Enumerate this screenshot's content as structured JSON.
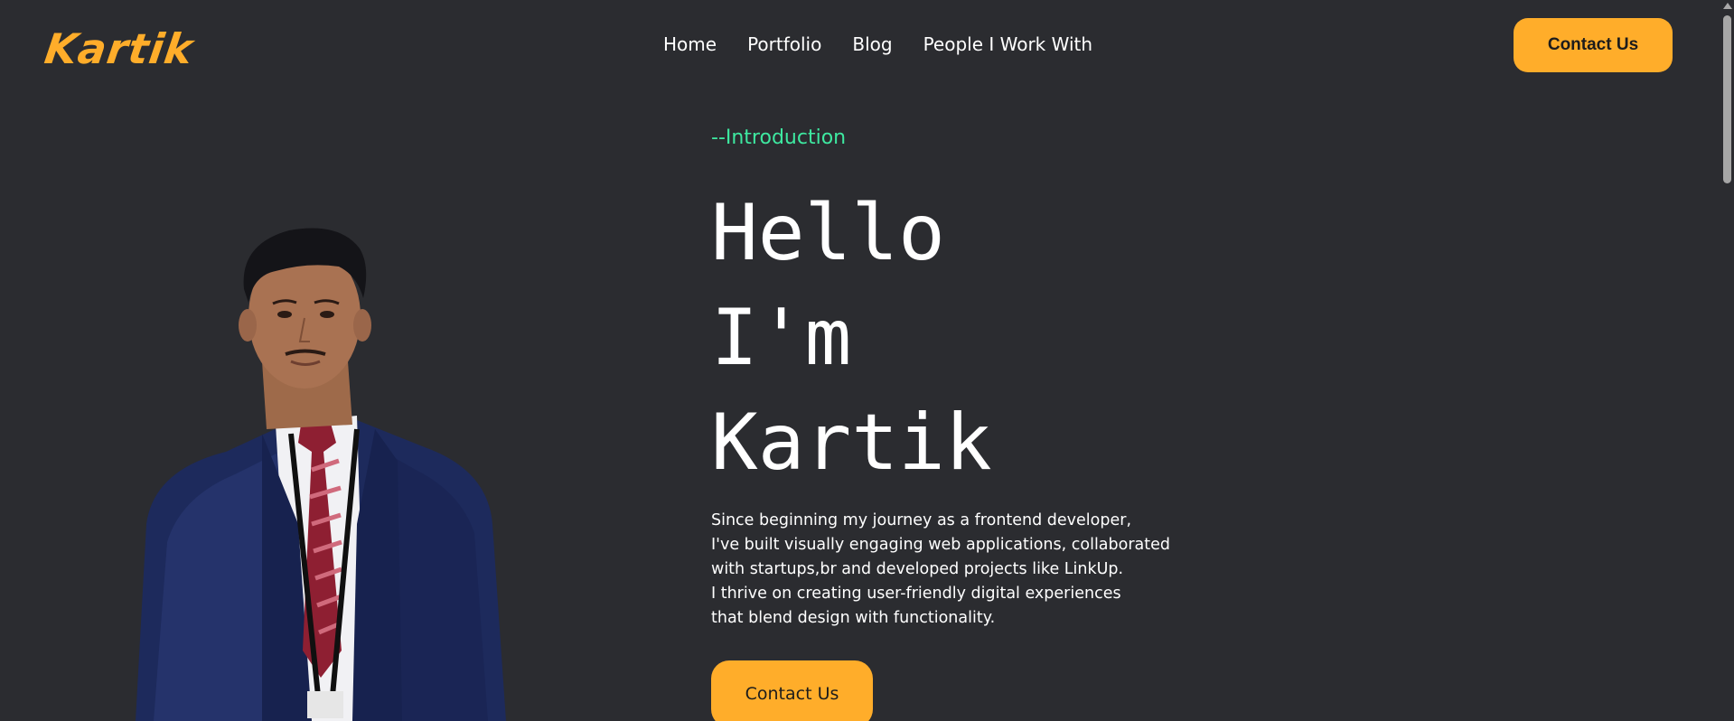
{
  "header": {
    "logo": "Kartik",
    "nav": [
      "Home",
      "Portfolio",
      "Blog",
      "People I Work With"
    ],
    "cta_label": "Contact Us"
  },
  "hero": {
    "eyebrow": "--Introduction",
    "headline": [
      "Hello",
      "I'm",
      "Kartik"
    ],
    "bio": [
      "Since beginning my journey as a frontend developer,",
      "I've built visually engaging web applications, collaborated",
      "with startups,br and developed projects like LinkUp.",
      "I thrive on creating user-friendly digital experiences",
      "that blend design with functionality."
    ],
    "cta_label": "Contact Us"
  },
  "colors": {
    "background": "#2b2c30",
    "accent": "#ffad2a",
    "intro": "#3ee8a0"
  },
  "icons": {
    "portrait": "person-photo",
    "scroll_up": "arrow-up-icon"
  }
}
